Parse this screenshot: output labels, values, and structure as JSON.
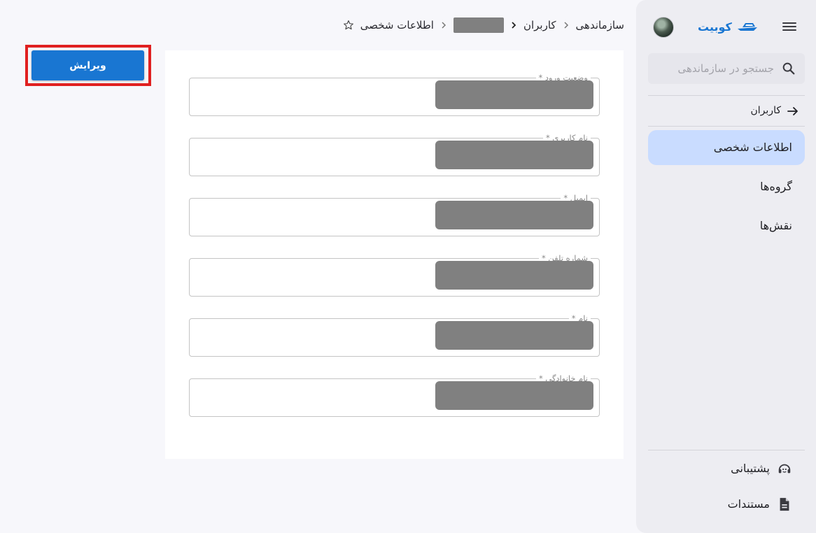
{
  "sidebar": {
    "brand_name": "کوبیت",
    "search_placeholder": "جستجو در سازماندهی",
    "back_label": "کاربران",
    "nav": [
      {
        "label": "اطلاعات شخصی",
        "active": true
      },
      {
        "label": "گروه‌ها",
        "active": false
      },
      {
        "label": "نقش‌ها",
        "active": false
      }
    ],
    "footer": [
      {
        "label": "پشتیبانی",
        "icon": "support-icon"
      },
      {
        "label": "مستندات",
        "icon": "document-icon"
      }
    ]
  },
  "breadcrumb": {
    "items": [
      "سازماندهی",
      "کاربران",
      "اطلاعات شخصی"
    ]
  },
  "toolbar": {
    "edit_label": "ویرایش"
  },
  "form": {
    "fields": [
      {
        "label": "وضعیت ورود *"
      },
      {
        "label": "نام کاربری *"
      },
      {
        "label": "ایمیل *"
      },
      {
        "label": "شماره تلفن *"
      },
      {
        "label": "نام *"
      },
      {
        "label": "نام خانوادگی *"
      }
    ]
  },
  "colors": {
    "accent": "#1976d2",
    "highlight": "#e02020",
    "active_nav": "#c9dcff",
    "sidebar_bg": "#ededf2",
    "redacted": "#808080"
  }
}
